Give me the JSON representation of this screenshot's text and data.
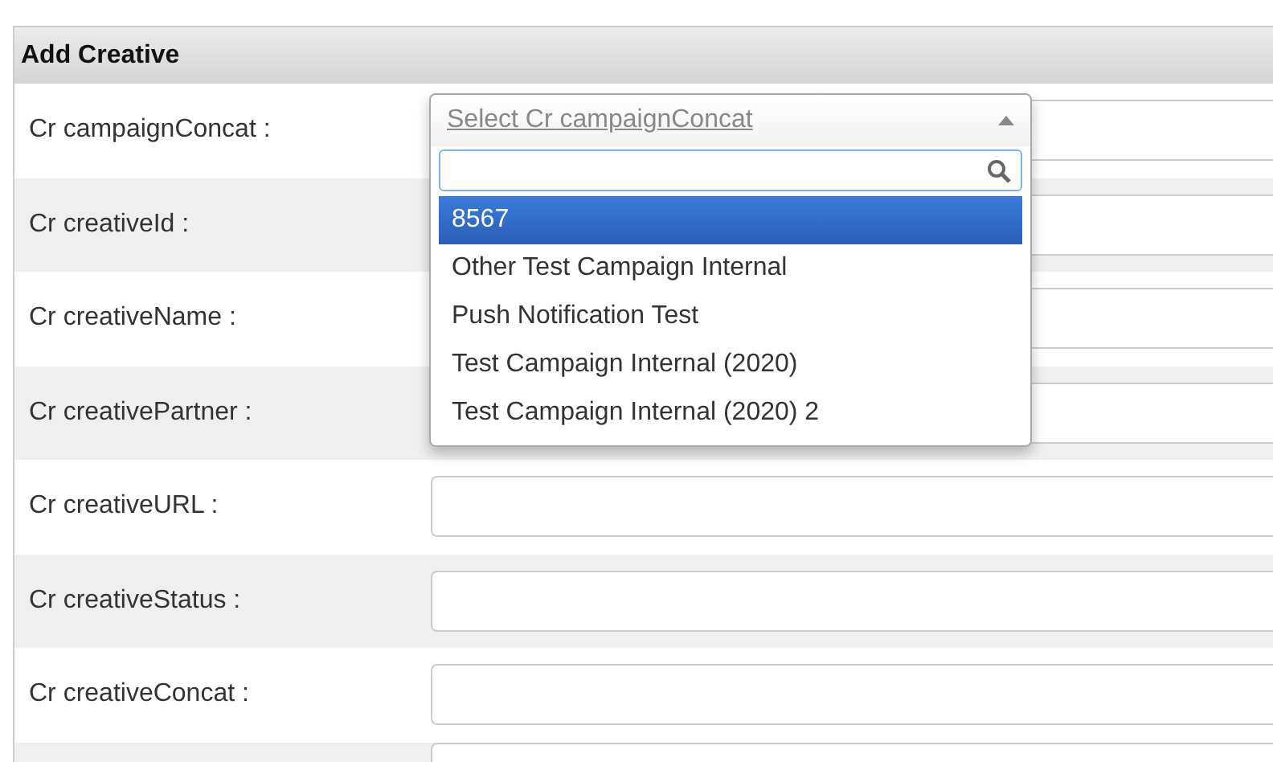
{
  "panel": {
    "title": "Add Creative"
  },
  "rows": [
    {
      "label": "Cr campaignConcat :"
    },
    {
      "label": "Cr creativeId :"
    },
    {
      "label": "Cr creativeName :"
    },
    {
      "label": "Cr creativePartner :"
    },
    {
      "label": "Cr creativeURL :"
    },
    {
      "label": "Cr creativeStatus :"
    },
    {
      "label": "Cr creativeConcat :"
    },
    {}
  ],
  "dropdown": {
    "placeholder": "Select Cr campaignConcat",
    "expanded": true,
    "options": [
      {
        "label": "8567",
        "selected": true
      },
      {
        "label": "Other Test Campaign Internal",
        "selected": false
      },
      {
        "label": "Push Notification Test",
        "selected": false
      },
      {
        "label": "Test Campaign Internal (2020)",
        "selected": false
      },
      {
        "label": "Test Campaign Internal (2020) 2",
        "selected": false
      }
    ]
  }
}
